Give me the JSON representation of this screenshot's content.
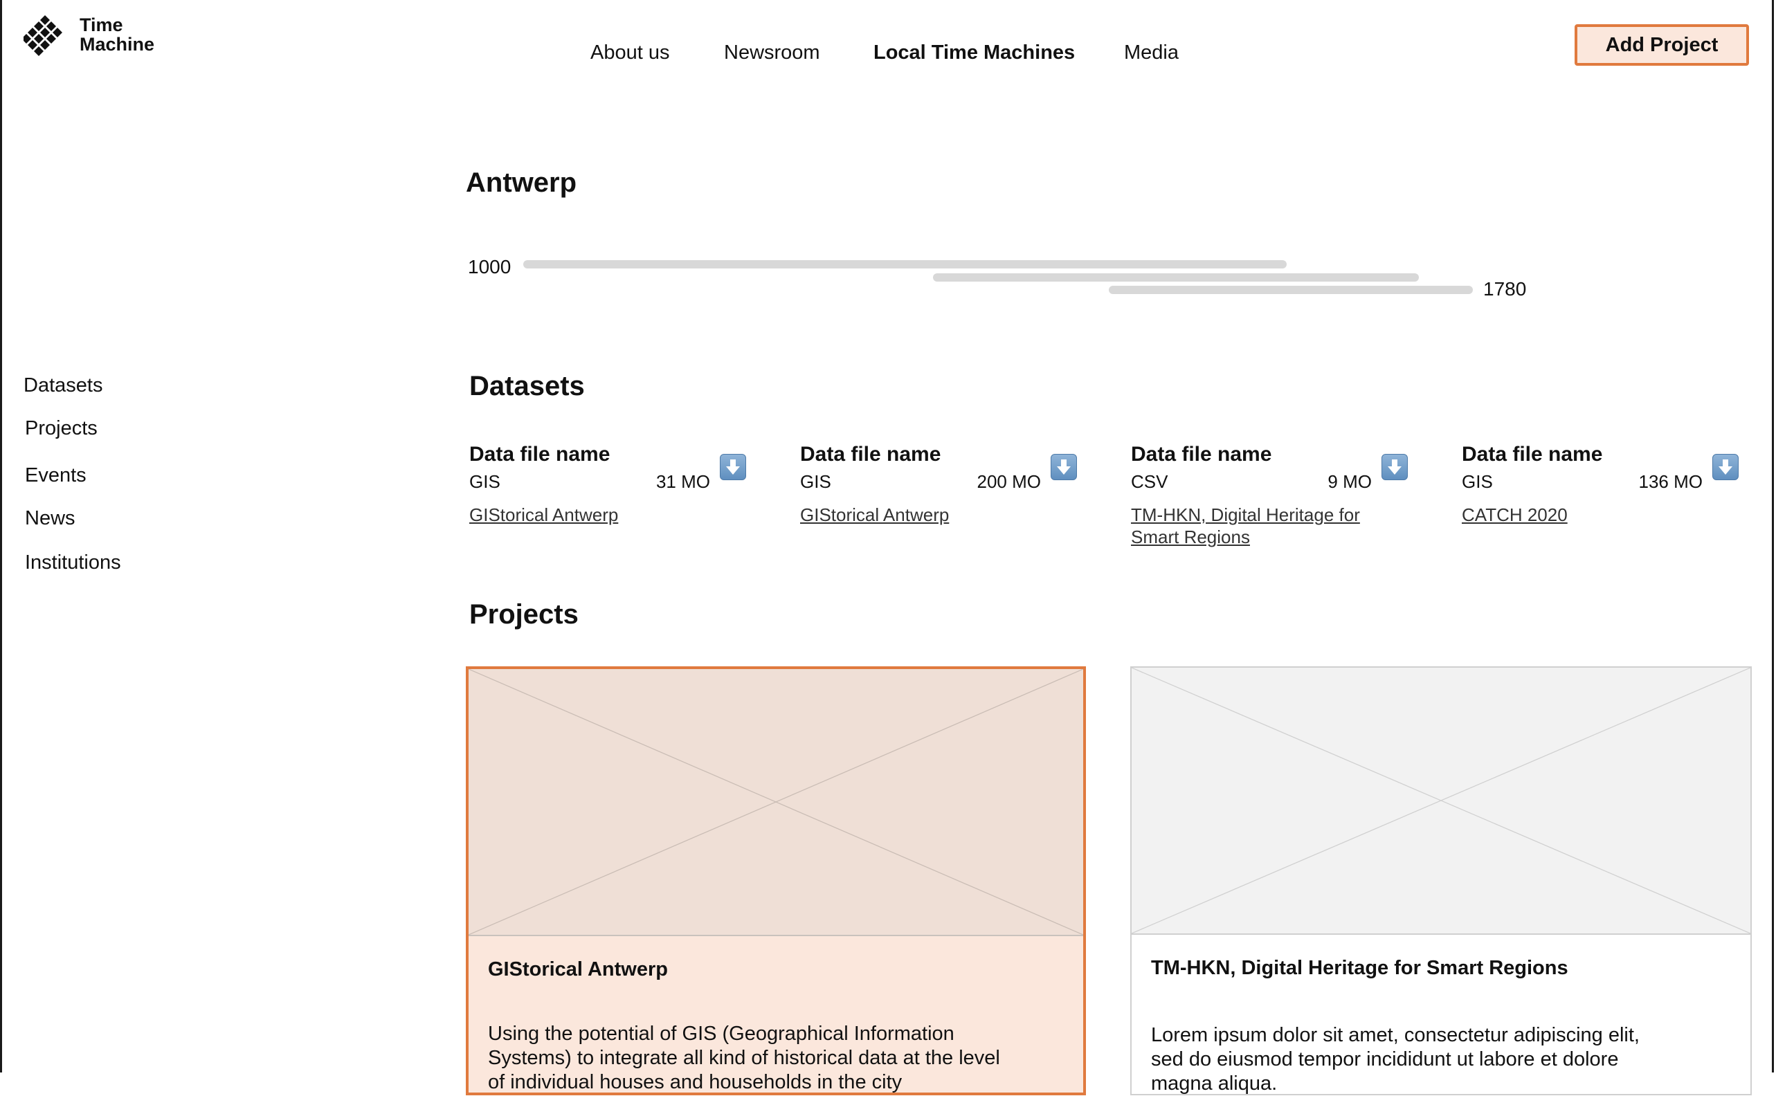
{
  "brand": {
    "line1": "Time",
    "line2": "Machine"
  },
  "nav": {
    "items": [
      "About us",
      "Newsroom",
      "Local Time Machines",
      "Media"
    ],
    "active": "Local Time Machines"
  },
  "header": {
    "add_project_label": "Add Project"
  },
  "sidebar": {
    "items": [
      "Datasets",
      "Projects",
      "Events",
      "News",
      "Institutions"
    ]
  },
  "city": {
    "name": "Antwerp"
  },
  "timeline": {
    "start_label": "1000",
    "end_label": "1780",
    "start_year": 1000,
    "end_year": 1780
  },
  "datasets": {
    "heading": "Datasets",
    "items": [
      {
        "name": "Data file name",
        "type": "GIS",
        "size": "31 MO",
        "link": "GIStorical Antwerp"
      },
      {
        "name": "Data file name",
        "type": "GIS",
        "size": "200 MO",
        "link": "GIStorical Antwerp"
      },
      {
        "name": "Data file name",
        "type": "CSV",
        "size": "9 MO",
        "link": "TM-HKN, Digital Heritage for Smart Regions"
      },
      {
        "name": "Data file name",
        "type": "GIS",
        "size": "136 MO",
        "link": "CATCH 2020"
      }
    ]
  },
  "projects": {
    "heading": "Projects",
    "items": [
      {
        "title": "GIStorical Antwerp",
        "text": "Using the potential of GIS (Geographical Information Systems) to integrate all kind of historical data at the level of individual houses and households in the city"
      },
      {
        "title": "TM-HKN, Digital Heritage for Smart Regions",
        "text": "Lorem ipsum dolor sit amet, consectetur adipiscing elit, sed do eiusmod tempor incididunt ut labore et dolore magna aliqua."
      }
    ]
  },
  "colors": {
    "accent": "#e07a3e",
    "accent_bg": "#fbe7dc",
    "timeline_bar": "#d8d8d8"
  }
}
